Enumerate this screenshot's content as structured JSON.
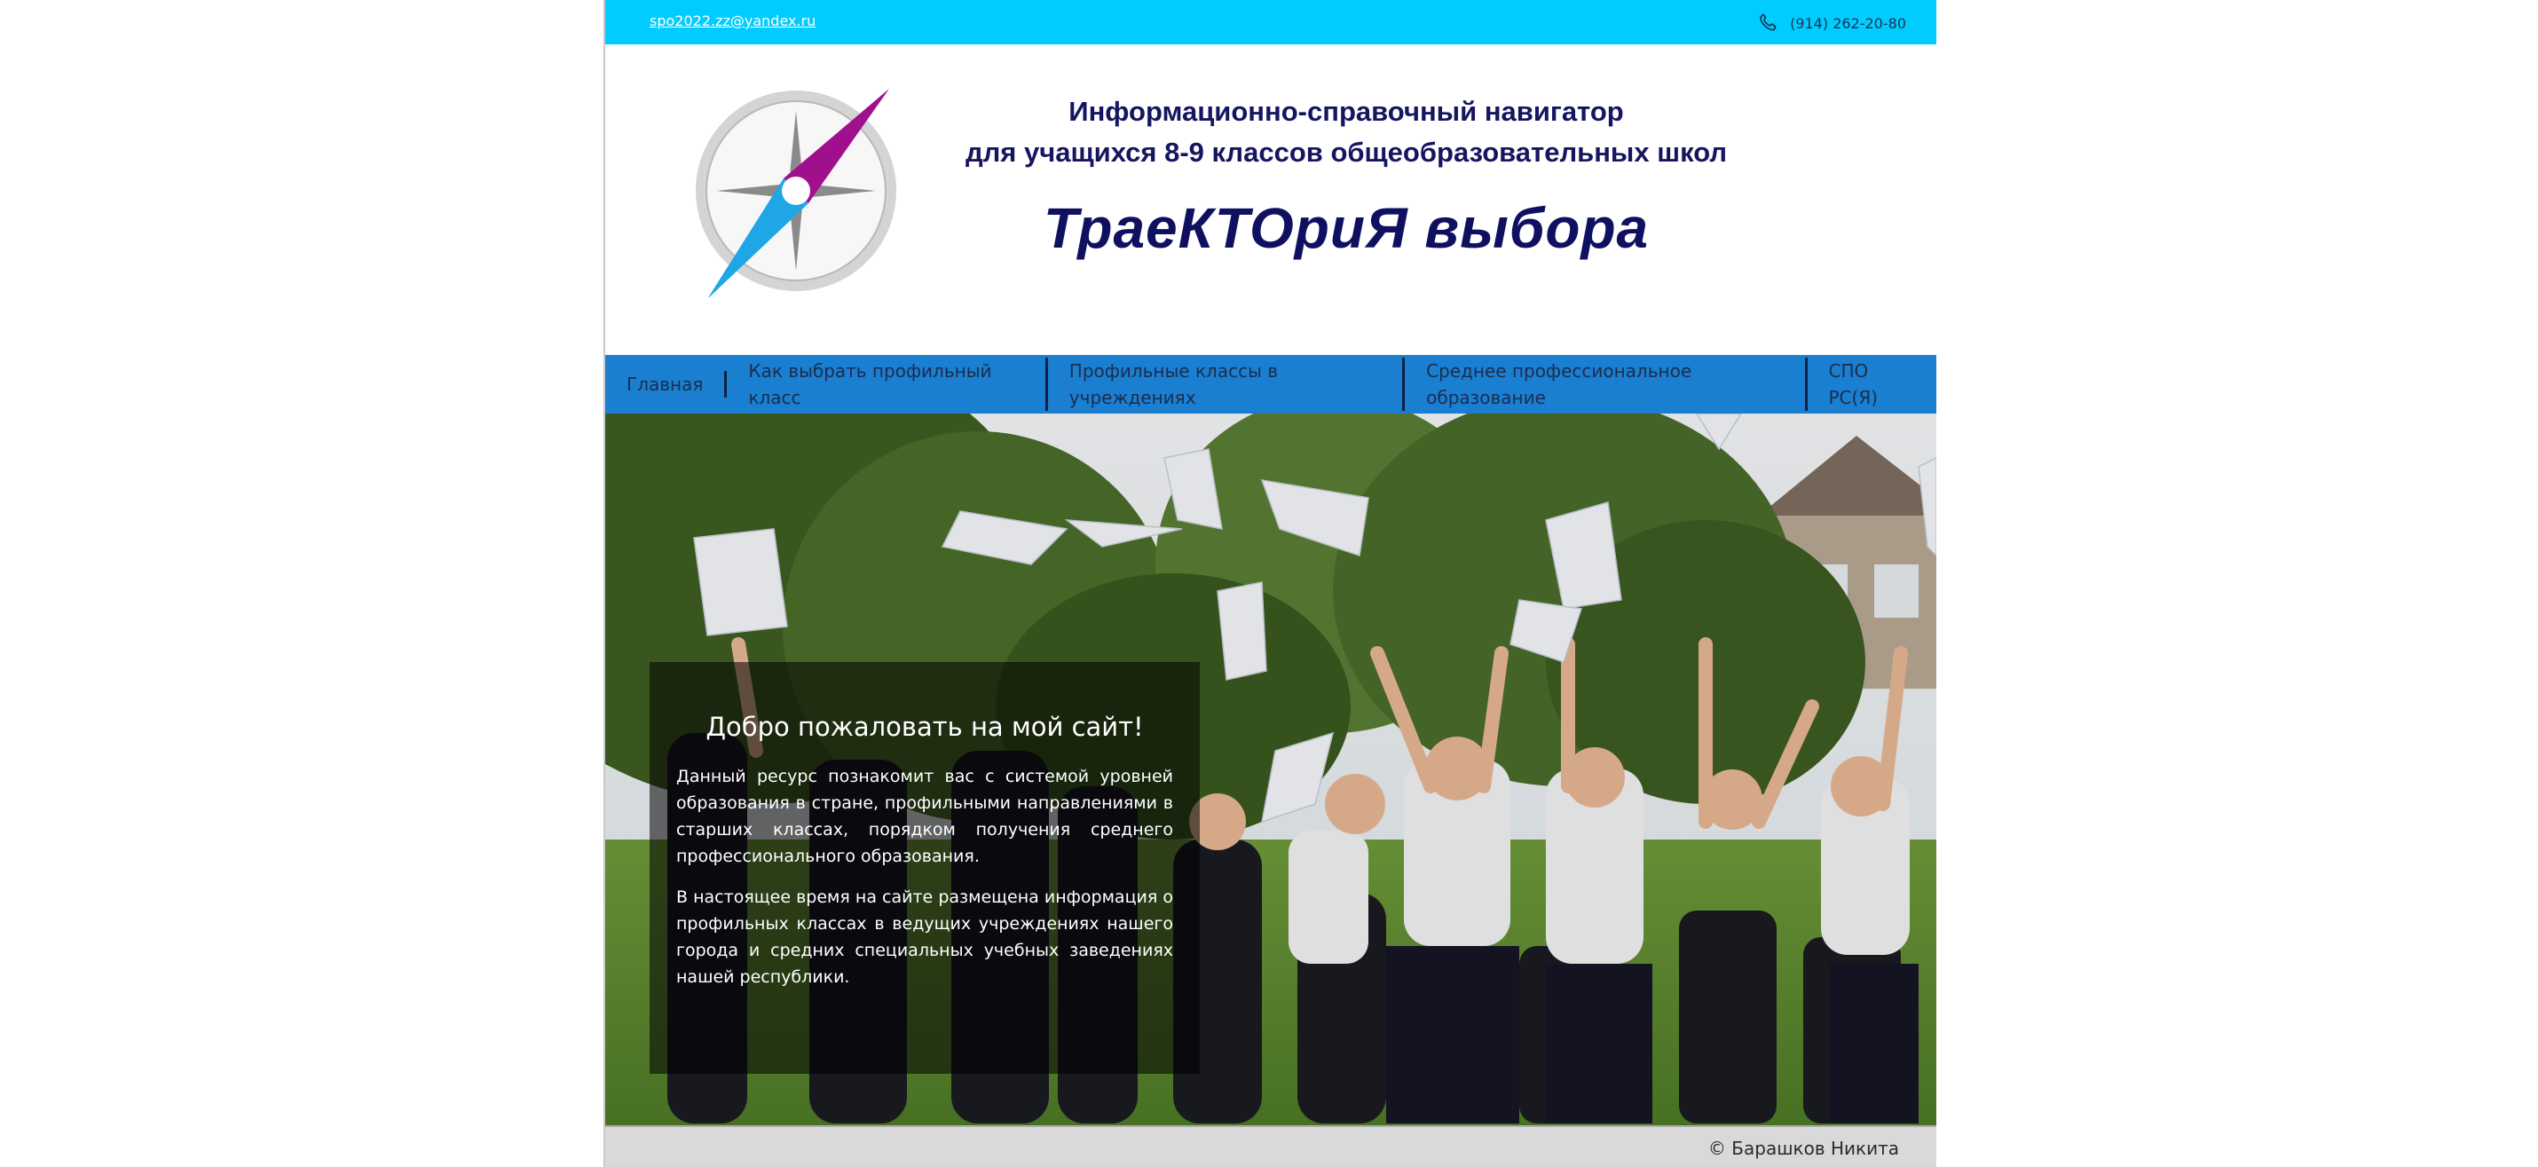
{
  "topbar": {
    "email": "spo2022.zz@yandex.ru",
    "phone": "(914) 262-20-80",
    "phone_icon": "phone-icon"
  },
  "header": {
    "logo_icon": "compass-icon",
    "subtitle_line1": "Информационно-справочный навигатор",
    "subtitle_line2": "для учащихся 8-9 классов общеобразовательных школ",
    "brand": "ТраеКТОриЯ выбора"
  },
  "nav": {
    "items": [
      {
        "label": "Главная"
      },
      {
        "label": "Как выбрать профильный класс"
      },
      {
        "label": "Профильные классы в учреждениях"
      },
      {
        "label": "Среднее профессиональное образование"
      },
      {
        "label": "СПО РС(Я)"
      }
    ]
  },
  "welcome": {
    "title": "Добро пожаловать на мой сайт!",
    "paragraph1": "Данный ресурс познакомит вас с системой уровней образования в стране, профильными направлениями в старших классах, порядком получения среднего профессионального образования.",
    "paragraph2": "В настоящее время на сайте размещена информация о профильных классах в ведущих учреждениях нашего города и средних специальных учебных заведениях нашей республики."
  },
  "footer": {
    "copyright": "© Барашков Никита"
  },
  "colors": {
    "topbar": "#00ccff",
    "nav": "#1a7fd0",
    "title": "#151560",
    "compass_magenta": "#a0108c",
    "compass_blue": "#1ea6e6"
  }
}
